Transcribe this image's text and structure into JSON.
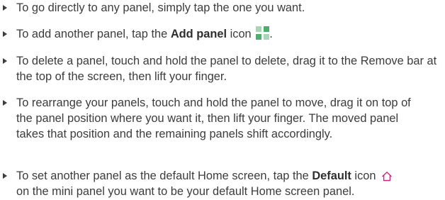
{
  "colors": {
    "text": "#3c3c3c",
    "add_icon_cells": [
      "#a8d5b6",
      "#4fae6d",
      "#4fae6d",
      "#a8d5b6"
    ],
    "home_icon": "#d3237a"
  },
  "icons": {
    "add_panel": "add-panel-icon",
    "default_home": "home-icon",
    "bullet": "triangle-bullet-icon"
  },
  "instructions": [
    {
      "text": "To go directly to any panel, simply tap the one you want."
    },
    {
      "before": "To add another panel, tap the ",
      "bold": "Add panel",
      "after": " icon",
      "end": "."
    },
    {
      "text": "To delete a panel, touch and hold the panel to delete, drag it to the Remove bar at the top of the screen, then lift your finger."
    },
    {
      "text": "To rearrange your panels, touch and hold the panel to move, drag it on top of the panel position where you want it, then lift your finger. The moved panel takes that position and the remaining panels shift accordingly."
    },
    {
      "before": "To set another panel as the default Home screen, tap the ",
      "bold": "Default",
      "after": " icon",
      "end": "on the mini panel you want to be your default Home screen panel."
    }
  ]
}
